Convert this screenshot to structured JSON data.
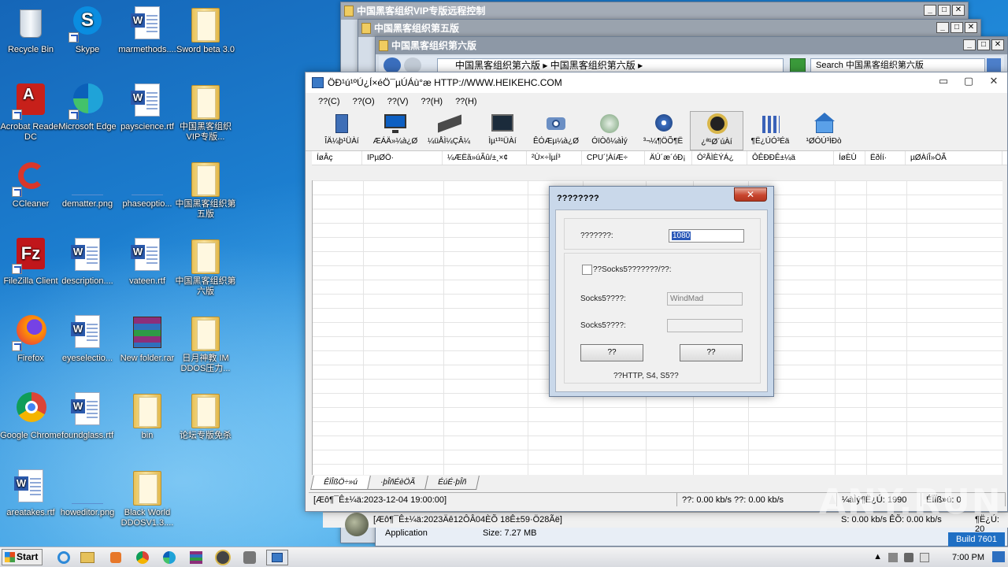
{
  "desktop": {
    "icons": [
      {
        "label": "Recycle Bin"
      },
      {
        "label": "Skype"
      },
      {
        "label": "marmethods...."
      },
      {
        "label": "Sword beta 3.0"
      },
      {
        "label": "Acrobat Reader DC"
      },
      {
        "label": "Microsoft Edge"
      },
      {
        "label": "payscience.rtf"
      },
      {
        "label": "中国黑客组织VIP专版..."
      },
      {
        "label": "CCleaner"
      },
      {
        "label": "dematter.png"
      },
      {
        "label": "phaseoptio..."
      },
      {
        "label": "中国黑客组织第五版"
      },
      {
        "label": "FileZilla Client"
      },
      {
        "label": "description...."
      },
      {
        "label": "vateen.rtf"
      },
      {
        "label": "中国黑客组织第六版"
      },
      {
        "label": "Firefox"
      },
      {
        "label": "eyeselectio..."
      },
      {
        "label": "New folder.rar"
      },
      {
        "label": "日月神教 IM DDOS压力..."
      },
      {
        "label": "Google Chrome"
      },
      {
        "label": "foundglass.rtf"
      },
      {
        "label": "bin"
      },
      {
        "label": "论坛专版免杀"
      },
      {
        "label": "areatakes.rtf"
      },
      {
        "label": "howeditor.png"
      },
      {
        "label": "Black World DDOSV1.3...."
      }
    ]
  },
  "bg_windows": {
    "win1_title": "中国黑客组织VIP专版远程控制",
    "win2_title": "中国黑客组织第五版",
    "win3_title": "中国黑客组织第六版",
    "breadcrumb_1": "中国黑客组织第六版",
    "breadcrumb_2": "中国黑客组织第六版",
    "search_placeholder": "Search 中国黑客组织第六版",
    "bottom_status": "[Æô¶¯Ê±¼ä:2023Äê12ÔÂ04ÈÕ 18Ê±59·Ö28Ãë]",
    "bottom_speed": "S: 0.00 kb/s ÊÕ: 0.00 kb/s",
    "bottom_right": "¶Ë¿Ú: 20",
    "app_label": "Application",
    "size_label": "Size: 7.27 MB"
  },
  "app": {
    "title": "ÖÐ¹ú¹ºÚ¿Í×éÖ¯µÚÁù°æ HTTP://WWW.HEIKEHC.COM",
    "menu": [
      "??(C)",
      "??(O)",
      "??(V)",
      "??(H)",
      "??(H)"
    ],
    "tools": [
      {
        "label": "ÎÄ¼þ¹ÜÀí",
        "icon": "file-manager-icon"
      },
      {
        "label": "ÆÁÄ»¼à¿Ø",
        "icon": "screen-monitor-icon"
      },
      {
        "label": "¼üÅÌ¼ÇÂ¼",
        "icon": "keyboard-icon"
      },
      {
        "label": "Ìµ¹³¹ÜÀí",
        "icon": "terminal-icon"
      },
      {
        "label": "ÊÓÆµ¼à¿Ø",
        "icon": "camera-icon"
      },
      {
        "label": "ÓïÒô¼àÌý",
        "icon": "audio-icon"
      },
      {
        "label": "³¬¼¶ÖÕ¶Ë",
        "icon": "terminal-gear-icon"
      },
      {
        "label": "¿ª¹Ø´úÀí",
        "icon": "proxy-icon"
      },
      {
        "label": "¶Ë¿ÚÓ³Éä",
        "icon": "port-map-icon"
      },
      {
        "label": "¹ØÓÚ³ÌÐò",
        "icon": "about-icon"
      }
    ],
    "columns": [
      "ÍøÂç",
      "IPµØÖ·",
      "¼ÆËã»úÃû/±¸×¢",
      "²Ù×÷ÏµÍ³",
      "CPU´¦ÀíÆ÷",
      "ÄÚ´æ´óÐ¡",
      "Ó²ÅÌÈÝÁ¿",
      "ÔÊÐÐÊ±¼ä",
      "ÍøÈÙ",
      "ËðÍí·",
      "µØÀíÎ»ÖÃ"
    ],
    "tabs": [
      "ÊÏÎßÖ÷»ú",
      "·þÎñÉèÖÃ",
      "ÉúÉ·þÎñ"
    ],
    "status": {
      "start_time": "[Æô¶¯Ê±¼ä:2023-12-04 19:00:00]",
      "speed": "??: 0.00 kb/s ??: 0.00 kb/s",
      "port": "¼àÌý¶Ë¿Ú: 1990",
      "online": "ÉÏÏß»ú: 0"
    }
  },
  "dialog": {
    "title": "????????",
    "close": "✕",
    "port_label": "???????:",
    "port_value": "1080",
    "socks_checkbox": "??Socks5???????/??:",
    "socks_user_label": "Socks5????:",
    "socks_user_value": "WindMad",
    "socks_pass_label": "Socks5????:",
    "socks_pass_value": "",
    "ok": "??",
    "cancel": "??",
    "note": "??HTTP, S4, S5??"
  },
  "taskbar": {
    "start": "Start",
    "clock": "7:00 PM"
  },
  "watermark": "ANY.RUN",
  "build": "Build 7601"
}
